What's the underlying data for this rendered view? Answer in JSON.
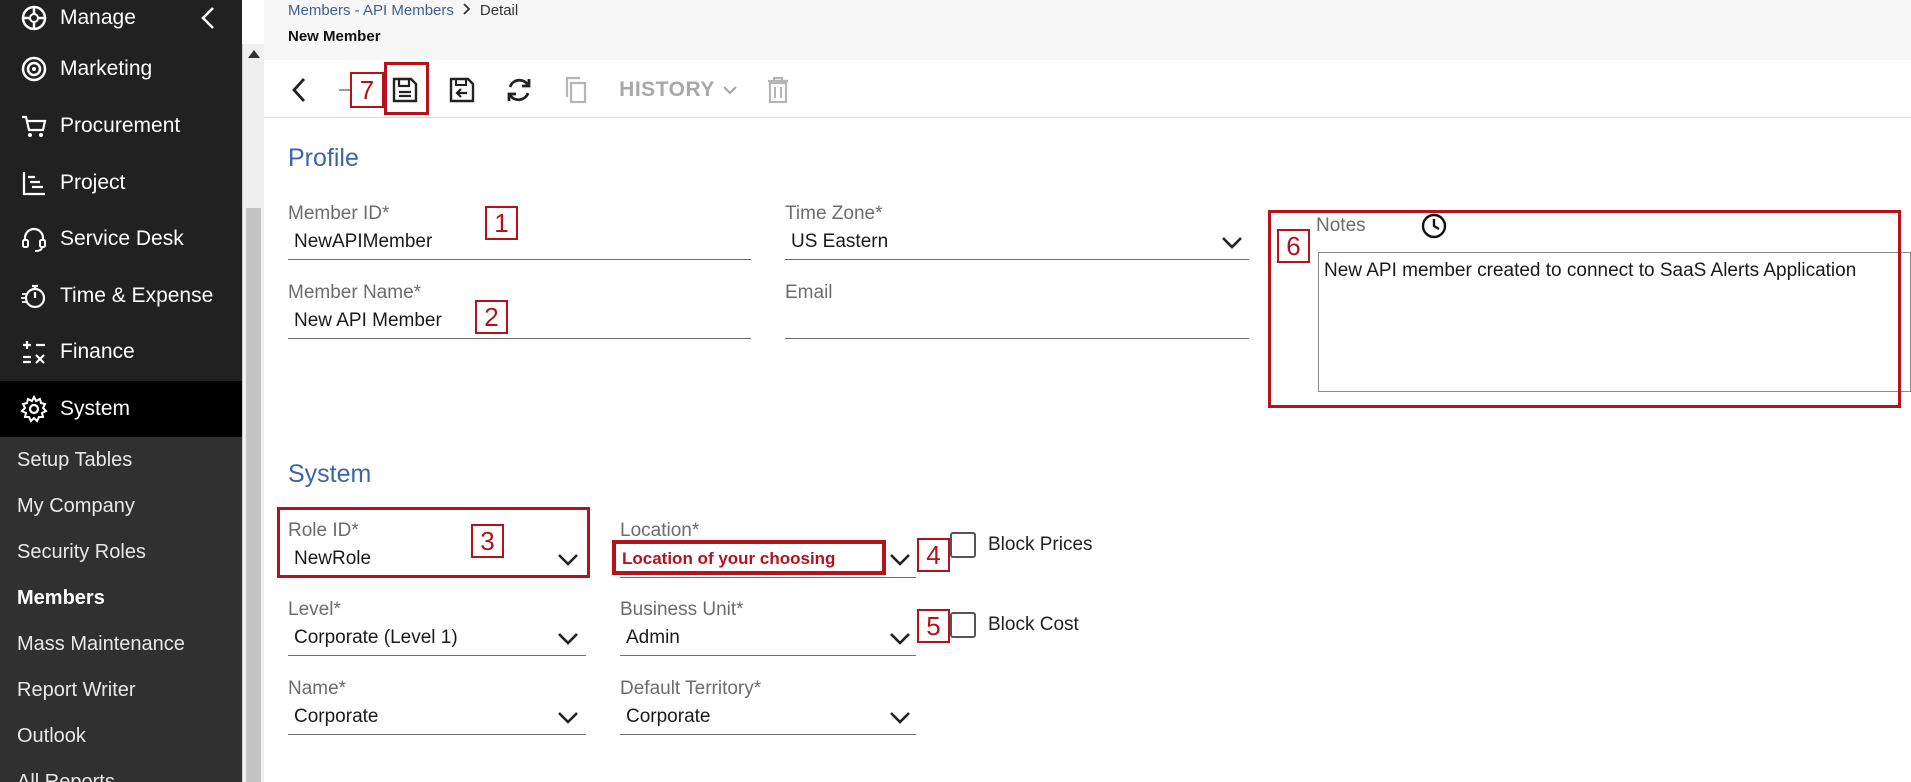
{
  "sidebar": {
    "main_items": [
      {
        "label": "Manage",
        "icon": "manage-icon"
      },
      {
        "label": "Marketing",
        "icon": "target-icon"
      },
      {
        "label": "Procurement",
        "icon": "cart-icon"
      },
      {
        "label": "Project",
        "icon": "project-icon"
      },
      {
        "label": "Service Desk",
        "icon": "headset-icon"
      },
      {
        "label": "Time & Expense",
        "icon": "stopwatch-icon"
      },
      {
        "label": "Finance",
        "icon": "finance-icon"
      },
      {
        "label": "System",
        "icon": "gear-icon"
      }
    ],
    "sub_items": [
      {
        "label": "Setup Tables"
      },
      {
        "label": "My Company"
      },
      {
        "label": "Security Roles"
      },
      {
        "label": "Members"
      },
      {
        "label": "Mass Maintenance"
      },
      {
        "label": "Report Writer"
      },
      {
        "label": "Outlook"
      },
      {
        "label": "All Reports"
      }
    ]
  },
  "header": {
    "breadcrumb_parent": "Members - API Members",
    "breadcrumb_current": "Detail",
    "page_title": "New Member"
  },
  "toolbar": {
    "history_label": "HISTORY"
  },
  "profile": {
    "section_title": "Profile",
    "member_id_label": "Member ID*",
    "member_id_value": "NewAPIMember",
    "member_name_label": "Member Name*",
    "member_name_value": "New API Member",
    "time_zone_label": "Time Zone*",
    "time_zone_value": "US Eastern",
    "email_label": "Email",
    "email_value": "",
    "notes_label": "Notes",
    "notes_value": "New API member created to connect to SaaS Alerts Application"
  },
  "system": {
    "section_title": "System",
    "role_id_label": "Role ID*",
    "role_id_value": "NewRole",
    "location_label": "Location*",
    "location_value": "Location of your choosing",
    "level_label": "Level*",
    "level_value": "Corporate (Level 1)",
    "business_unit_label": "Business Unit*",
    "business_unit_value": "Admin",
    "name_label": "Name*",
    "name_value": "Corporate",
    "default_territory_label": "Default Territory*",
    "default_territory_value": "Corporate",
    "block_prices_label": "Block Prices",
    "block_cost_label": "Block Cost"
  },
  "callouts": [
    "1",
    "2",
    "3",
    "4",
    "5",
    "6",
    "7"
  ],
  "colors": {
    "accent_blue": "#3d66a8",
    "callout_red": "#b5121b",
    "sidebar_bg": "#212121"
  }
}
